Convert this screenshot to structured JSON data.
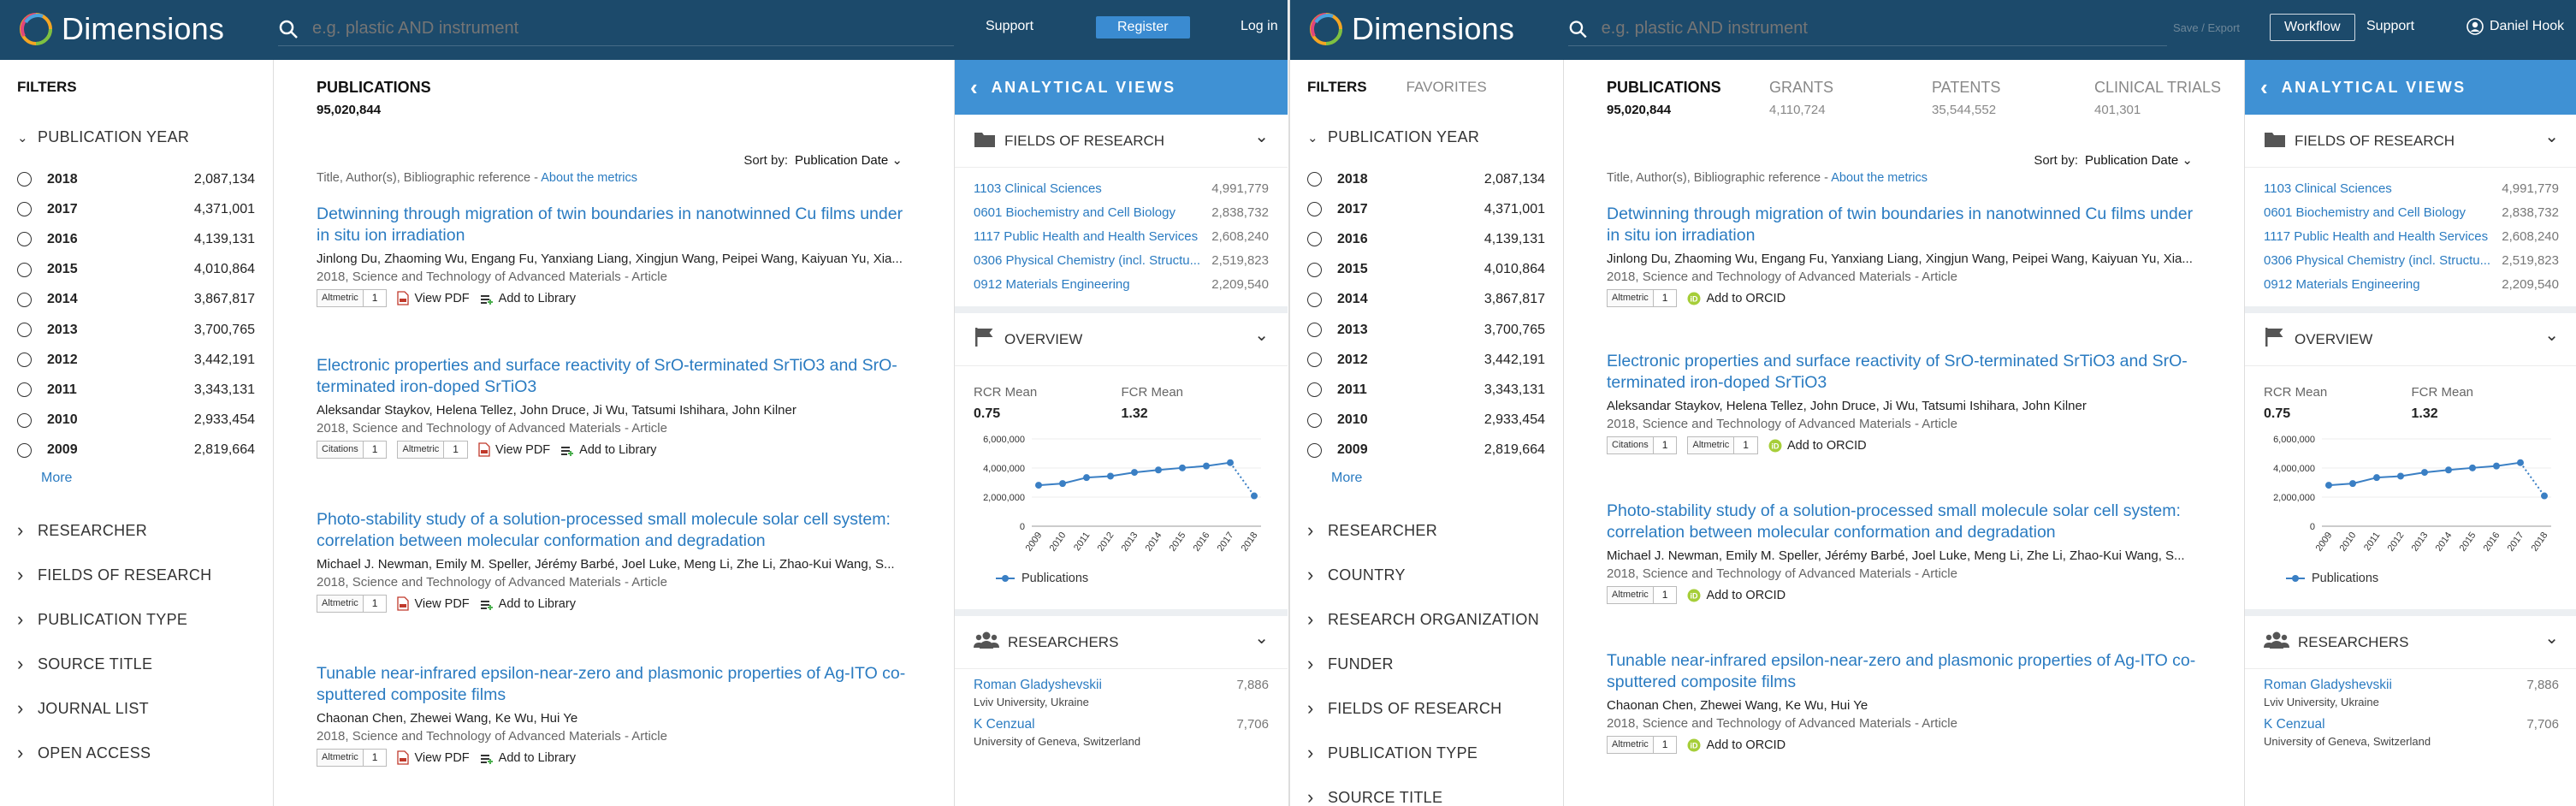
{
  "brand": {
    "name": "Dimensions"
  },
  "search": {
    "placeholder": "e.g. plastic AND instrument"
  },
  "left": {
    "nav": {
      "support": "Support",
      "register": "Register",
      "login": "Log in"
    },
    "filters_label": "FILTERS",
    "pub_year_label": "PUBLICATION YEAR",
    "years": [
      {
        "year": "2018",
        "count": "2,087,134"
      },
      {
        "year": "2017",
        "count": "4,371,001"
      },
      {
        "year": "2016",
        "count": "4,139,131"
      },
      {
        "year": "2015",
        "count": "4,010,864"
      },
      {
        "year": "2014",
        "count": "3,867,817"
      },
      {
        "year": "2013",
        "count": "3,700,765"
      },
      {
        "year": "2012",
        "count": "3,442,191"
      },
      {
        "year": "2011",
        "count": "3,343,131"
      },
      {
        "year": "2010",
        "count": "2,933,454"
      },
      {
        "year": "2009",
        "count": "2,819,664"
      }
    ],
    "more": "More",
    "sections": [
      "RESEARCHER",
      "FIELDS OF RESEARCH",
      "PUBLICATION TYPE",
      "SOURCE TITLE",
      "JOURNAL LIST",
      "OPEN ACCESS"
    ],
    "tab": {
      "label": "PUBLICATIONS",
      "count": "95,020,844"
    },
    "sort": {
      "label": "Sort by:",
      "value": "Publication Date"
    },
    "biblio": {
      "text": "Title, Author(s), Bibliographic reference -",
      "link": "About the metrics"
    },
    "articles": [
      {
        "title": "Detwinning through migration of twin boundaries in nanotwinned Cu films under in situ ion irradiation",
        "authors": "Jinlong Du, Zhaoming Wu, Engang Fu, Yanxiang Liang, Xingjun Wang, Peipei Wang, Kaiyuan Yu, Xia...",
        "source": "2018, Science and Technology of Advanced Materials - Article",
        "altmetric": "1",
        "pdf": "View PDF",
        "library": "Add to Library"
      },
      {
        "title": "Electronic properties and surface reactivity of SrO-terminated SrTiO3 and SrO-terminated iron-doped SrTiO3",
        "authors": "Aleksandar Staykov, Helena Tellez, John Druce, Ji Wu, Tatsumi Ishihara, John Kilner",
        "source": "2018, Science and Technology of Advanced Materials - Article",
        "citations": "1",
        "altmetric": "1",
        "pdf": "View PDF",
        "library": "Add to Library"
      },
      {
        "title": "Photo-stability study of a solution-processed small molecule solar cell system: correlation between molecular conformation and degradation",
        "authors": "Michael J. Newman, Emily M. Speller, Jérémy Barbé, Joel Luke, Meng Li, Zhe Li, Zhao-Kui Wang, S...",
        "source": "2018, Science and Technology of Advanced Materials - Article",
        "altmetric": "1",
        "pdf": "View PDF",
        "library": "Add to Library"
      },
      {
        "title": "Tunable near-infrared epsilon-near-zero and plasmonic properties of Ag-ITO co-sputtered composite films",
        "authors": "Chaonan Chen, Zhewei Wang, Ke Wu, Hui Ye",
        "source": "2018, Science and Technology of Advanced Materials - Article",
        "altmetric": "1",
        "pdf": "View PDF",
        "library": "Add to Library"
      }
    ],
    "badge_labels": {
      "altmetric": "Altmetric",
      "citations": "Citations"
    }
  },
  "right": {
    "nav": {
      "save_export": "Save / Export",
      "workflow": "Workflow",
      "support": "Support",
      "user": "Daniel Hook"
    },
    "filters_label": "FILTERS",
    "favorites_label": "FAVORITES",
    "pub_year_label": "PUBLICATION YEAR",
    "more": "More",
    "sections": [
      "RESEARCHER",
      "COUNTRY",
      "RESEARCH ORGANIZATION",
      "FUNDER",
      "FIELDS OF RESEARCH",
      "PUBLICATION TYPE",
      "SOURCE TITLE"
    ],
    "tabs": [
      {
        "label": "PUBLICATIONS",
        "count": "95,020,844"
      },
      {
        "label": "GRANTS",
        "count": "4,110,724"
      },
      {
        "label": "PATENTS",
        "count": "35,544,552"
      },
      {
        "label": "CLINICAL TRIALS",
        "count": "401,301"
      }
    ],
    "orcid": "Add to ORCID"
  },
  "analytics": {
    "header": "ANALYTICAL VIEWS",
    "for_label": "FIELDS OF RESEARCH",
    "fields": [
      {
        "label": "1103 Clinical Sciences",
        "value": "4,991,779"
      },
      {
        "label": "0601 Biochemistry and Cell Biology",
        "value": "2,838,732"
      },
      {
        "label": "1117 Public Health and Health Services",
        "value": "2,608,240"
      },
      {
        "label": "0306 Physical Chemistry (incl. Structu...",
        "value": "2,519,823"
      },
      {
        "label": "0912 Materials Engineering",
        "value": "2,209,540"
      }
    ],
    "overview_label": "OVERVIEW",
    "rcr_label": "RCR Mean",
    "rcr_value": "0.75",
    "fcr_label": "FCR Mean",
    "fcr_value": "1.32",
    "researchers_label": "RESEARCHERS",
    "researchers": [
      {
        "name": "Roman Gladyshevskii",
        "aff": "Lviv University, Ukraine",
        "value": "7,886"
      },
      {
        "name": "K Cenzual",
        "aff": "University of Geneva, Switzerland",
        "value": "7,706"
      }
    ]
  },
  "chart_data": {
    "type": "line",
    "x": [
      "2009",
      "2010",
      "2011",
      "2012",
      "2013",
      "2014",
      "2015",
      "2016",
      "2017",
      "2018"
    ],
    "series": [
      {
        "name": "Publications",
        "values": [
          2819664,
          2933454,
          3343131,
          3442191,
          3700765,
          3867817,
          4010864,
          4139131,
          4371001,
          2087134
        ]
      }
    ],
    "yticks": [
      "6,000,000",
      "4,000,000",
      "2,000,000",
      "0"
    ],
    "ylim": [
      0,
      6000000
    ],
    "color": "#3a7fc4",
    "last_segment": "dotted"
  }
}
